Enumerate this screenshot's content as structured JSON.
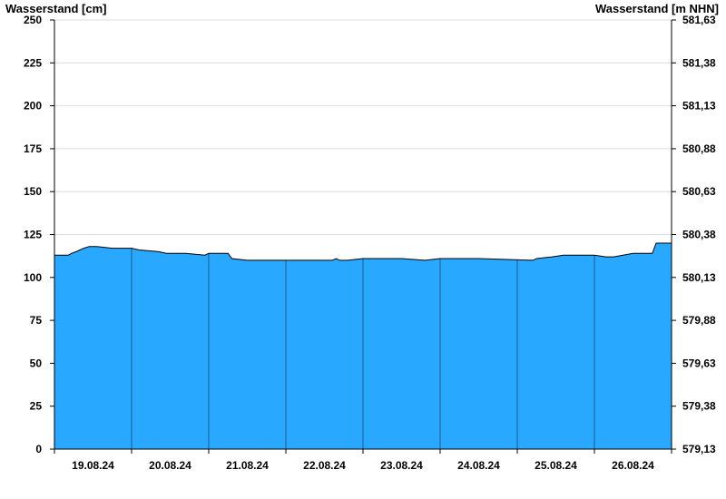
{
  "chart_data": {
    "type": "area",
    "ylabel": "Wasserstand [cm]",
    "ylabel_right": "Wasserstand [m NHN]",
    "ylim": [
      0,
      250
    ],
    "yticks": [
      0,
      25,
      50,
      75,
      100,
      125,
      150,
      175,
      200,
      225,
      250
    ],
    "yticks_right": [
      "579,13",
      "579,38",
      "579,63",
      "579,88",
      "580,13",
      "580,38",
      "580,63",
      "580,88",
      "581,13",
      "581,38",
      "581,63"
    ],
    "x_day_labels": [
      "19.08.24",
      "20.08.24",
      "21.08.24",
      "22.08.24",
      "23.08.24",
      "24.08.24",
      "25.08.24",
      "26.08.24"
    ],
    "xlim_days": [
      0,
      8
    ],
    "grid": true,
    "fill_color": "#29a8ff",
    "line_color": "#000000",
    "series": [
      {
        "x": [
          0,
          0.18,
          0.22,
          0.28,
          0.33,
          0.38,
          0.45,
          0.55,
          0.75,
          1.0,
          1.1,
          1.35,
          1.45,
          1.5,
          1.7,
          1.95,
          2.0,
          2.25,
          2.3,
          2.5,
          3.0,
          3.5,
          3.6,
          3.65,
          3.7,
          3.8,
          4.0,
          4.5,
          4.8,
          5.0,
          5.5,
          6.2,
          6.25,
          6.45,
          6.6,
          6.8,
          7.0,
          7.15,
          7.25,
          7.5,
          7.75,
          7.8,
          8.0
        ],
        "y": [
          113,
          113,
          114,
          115,
          116,
          117,
          118,
          118,
          117,
          117,
          116,
          115,
          114,
          114,
          114,
          113,
          114,
          114,
          111,
          110,
          110,
          110,
          110,
          111,
          110,
          110,
          111,
          111,
          110,
          111,
          111,
          110,
          111,
          112,
          113,
          113,
          113,
          112,
          112,
          114,
          114,
          120,
          120
        ]
      }
    ]
  }
}
